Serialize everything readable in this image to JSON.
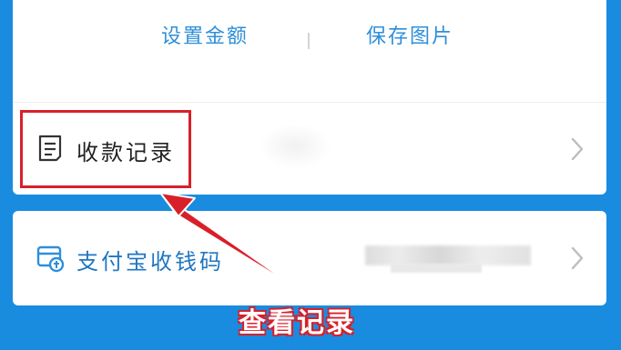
{
  "actions": {
    "set_amount": "设置金额",
    "save_image": "保存图片"
  },
  "rows": [
    {
      "label": "收款记录",
      "icon": "receipt-list-icon"
    },
    {
      "label": "支付宝收钱码",
      "icon": "alipay-cashier-icon"
    }
  ],
  "annotation": "查看记录",
  "colors": {
    "background": "#1a8ce0",
    "accent": "#2e8fd9",
    "highlight": "#d8202a"
  }
}
